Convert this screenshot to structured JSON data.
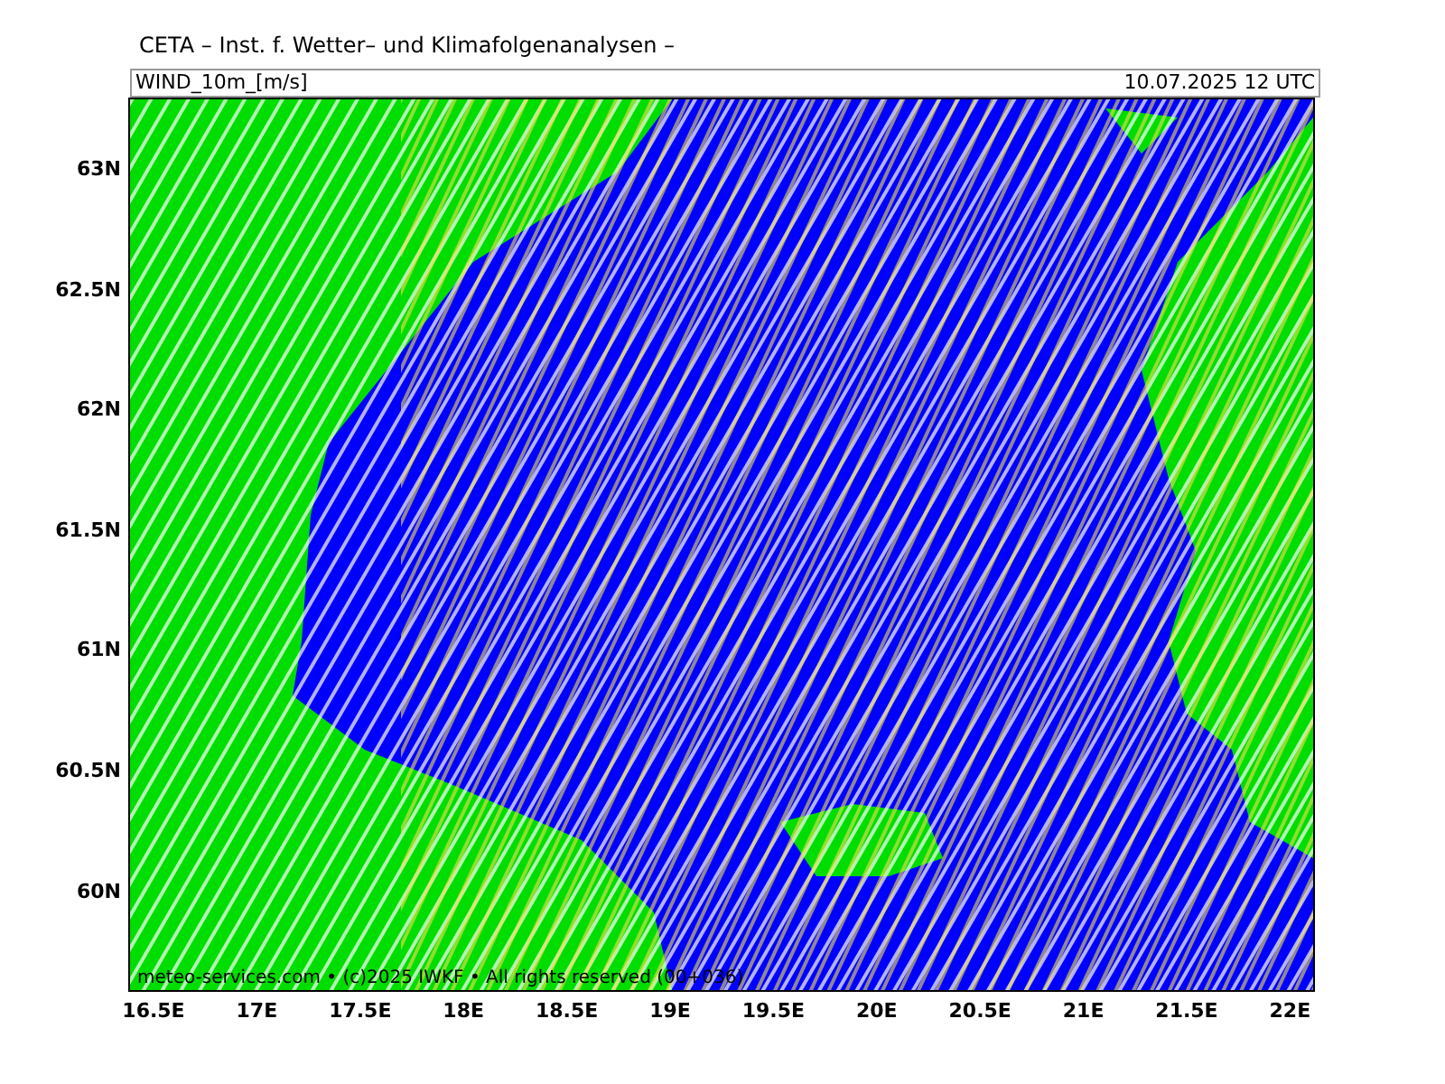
{
  "title": "CETA – Inst. f. Wetter– und Klimafolgenanalysen –",
  "panel": {
    "variable": "WIND_10m_[m/s]",
    "valid_time": "10.07.2025  12  UTC"
  },
  "map": {
    "credit": "meteo-services.com • (c)2025 IWKF • All rights reserved (00+036)",
    "lat_labels": [
      "63N",
      "62.5N",
      "62N",
      "61.5N",
      "61N",
      "60.5N",
      "60N"
    ],
    "lon_labels": [
      "16.5E",
      "17E",
      "17.5E",
      "18E",
      "18.5E",
      "19E",
      "19.5E",
      "20E",
      "20.5E",
      "21E",
      "21.5E",
      "22E"
    ]
  }
}
